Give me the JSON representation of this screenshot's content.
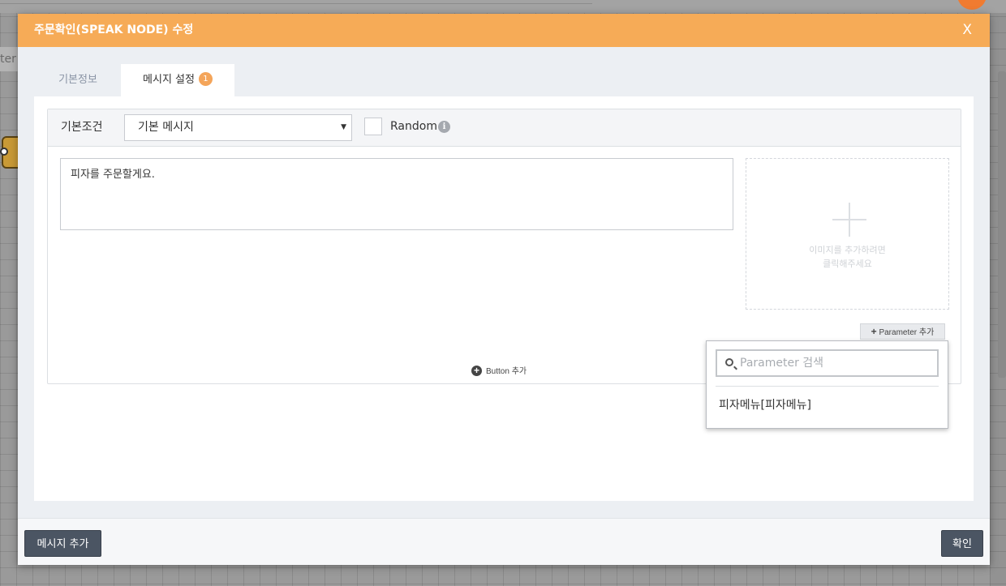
{
  "background": {
    "side_text": "ter"
  },
  "modal": {
    "title": "주문확인(SPEAK NODE) 수정",
    "close_label": "X",
    "header_color": "#f6ab57"
  },
  "tabs": [
    {
      "label": "기본정보",
      "active": false
    },
    {
      "label": "메시지 설정",
      "active": true,
      "badge": "1"
    }
  ],
  "condition": {
    "label": "기본조건",
    "selected": "기본 메시지",
    "arrow": "▼",
    "random_label": "Random",
    "random_checked": false,
    "info_icon": "i"
  },
  "message": {
    "text": "피자를 주문할게요."
  },
  "image_upload": {
    "hint_line1": "이미지를 추가하려면",
    "hint_line2": "클릭해주세요",
    "icon": "plus-icon"
  },
  "parameter": {
    "button_plus": "+",
    "button_label": "Parameter 추가",
    "search_placeholder": "Parameter 검색",
    "items": [
      "피자메뉴[피자메뉴]"
    ]
  },
  "button_add": {
    "icon": "+",
    "label": "Button 추가"
  },
  "footer": {
    "add_message_label": "메시지 추가",
    "confirm_label": "확인"
  }
}
